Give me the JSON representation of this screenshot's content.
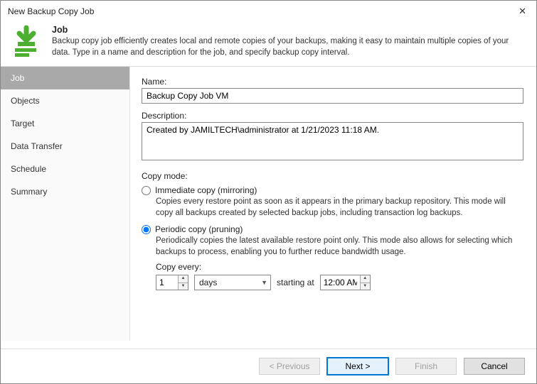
{
  "window": {
    "title": "New Backup Copy Job"
  },
  "header": {
    "title": "Job",
    "subtitle": "Backup copy job efficiently creates local and remote copies of your backups, making it easy to maintain multiple copies of your data. Type in a name and description for the job, and specify backup copy interval."
  },
  "sidebar": {
    "items": [
      {
        "label": "Job",
        "active": true
      },
      {
        "label": "Objects"
      },
      {
        "label": "Target"
      },
      {
        "label": "Data Transfer"
      },
      {
        "label": "Schedule"
      },
      {
        "label": "Summary"
      }
    ]
  },
  "fields": {
    "name_label": "Name:",
    "name_value": "Backup Copy Job VM",
    "desc_label": "Description:",
    "desc_value": "Created by JAMILTECH\\administrator at 1/21/2023 11:18 AM."
  },
  "copymode": {
    "label": "Copy mode:",
    "opt1_label": "Immediate copy (mirroring)",
    "opt1_desc": "Copies every restore point as soon as it appears in the primary backup repository. This mode will copy all backups created by selected backup jobs, including transaction log backups.",
    "opt2_label": "Periodic copy (pruning)",
    "opt2_desc": "Periodically copies the latest available restore point only. This mode also allows for selecting which backups to process, enabling you to further reduce bandwidth usage.",
    "copy_every_label": "Copy every:",
    "interval_value": "1",
    "interval_unit": "days",
    "starting_at_label": "starting at",
    "starting_time": "12:00 AM"
  },
  "footer": {
    "previous": "< Previous",
    "next": "Next >",
    "finish": "Finish",
    "cancel": "Cancel"
  }
}
